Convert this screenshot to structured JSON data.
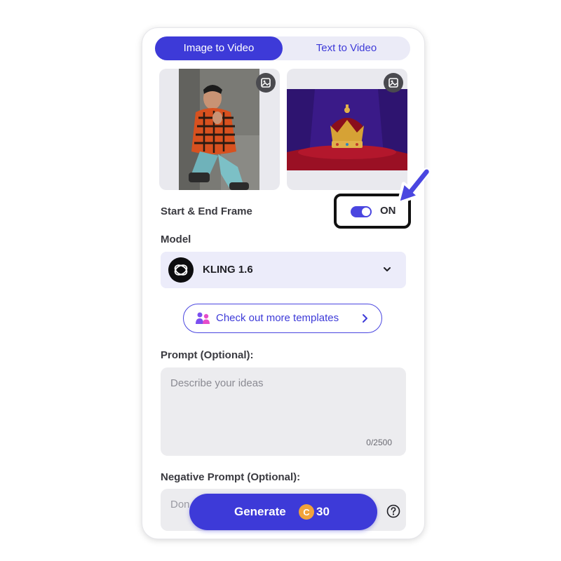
{
  "tabs": {
    "image_to_video": "Image to Video",
    "text_to_video": "Text to Video",
    "active": "Image to Video"
  },
  "frames": {
    "start_icon": "image-replace-icon",
    "end_icon": "image-replace-icon"
  },
  "start_end_frame": {
    "label": "Start & End Frame",
    "state": "ON",
    "enabled": true
  },
  "model": {
    "label": "Model",
    "selected": "KLING 1.6",
    "icon": "kling-logo-icon"
  },
  "templates_button": {
    "label": "Check out more templates",
    "icon": "people-icon"
  },
  "prompt": {
    "label": "Prompt (Optional):",
    "placeholder": "Describe your ideas",
    "counter": "0/2500"
  },
  "negative_prompt": {
    "label": "Negative Prompt (Optional):",
    "placeholder": "Don"
  },
  "generate": {
    "label": "Generate",
    "cost": "30",
    "coin_icon": "credit-coin-icon"
  },
  "colors": {
    "accent": "#3d3ad8",
    "arrow": "#4a46e0",
    "coin": "#f2a33a"
  }
}
